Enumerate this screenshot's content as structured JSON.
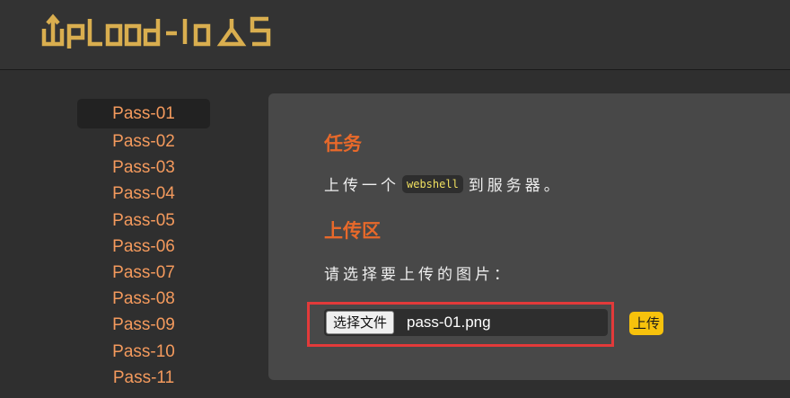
{
  "header": {
    "logo_text": "Upload-labs",
    "logo_color": "#d9ae4f"
  },
  "sidebar": {
    "items": [
      {
        "label": "Pass-01",
        "active": true
      },
      {
        "label": "Pass-02"
      },
      {
        "label": "Pass-03"
      },
      {
        "label": "Pass-04"
      },
      {
        "label": "Pass-05"
      },
      {
        "label": "Pass-06"
      },
      {
        "label": "Pass-07"
      },
      {
        "label": "Pass-08"
      },
      {
        "label": "Pass-09"
      },
      {
        "label": "Pass-10"
      },
      {
        "label": "Pass-11"
      }
    ]
  },
  "task": {
    "title": "任务",
    "text_before": "上传一个",
    "code": "webshell",
    "text_after": "到服务器。"
  },
  "upload": {
    "title": "上传区",
    "prompt": "请选择要上传的图片：",
    "choose_label": "选择文件",
    "file_name": "pass-01.png",
    "submit_label": "上传"
  },
  "colors": {
    "accent": "#e8692a",
    "nav_link": "#f49a5d",
    "highlight_border": "#e23a3a",
    "submit_button": "#f7c20c"
  }
}
